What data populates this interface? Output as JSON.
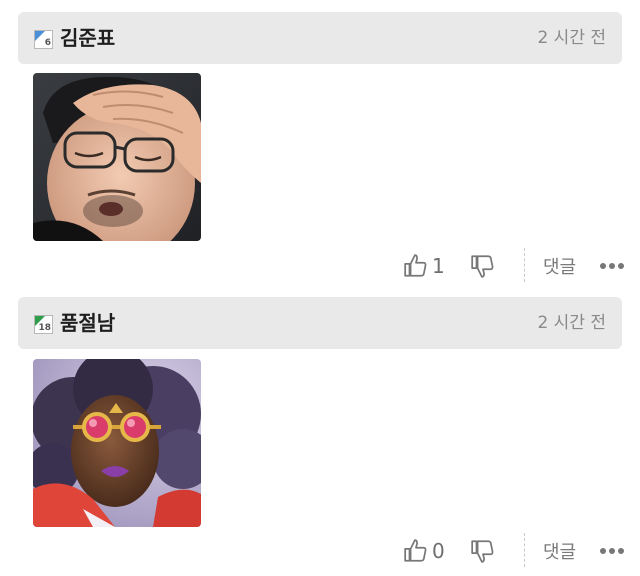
{
  "comments": [
    {
      "username": "김준표",
      "level": "6",
      "level_color": "#4a90d9",
      "time": "2 시간 전",
      "likes": "1",
      "reply_label": "댓글",
      "emoticon": "crying-man-facepalm"
    },
    {
      "username": "품절남",
      "level": "18",
      "level_color": "#2e9e4a",
      "time": "2 시간 전",
      "likes": "0",
      "reply_label": "댓글",
      "emoticon": "woman-with-goggles"
    }
  ],
  "icons": {
    "like": "thumbs-up-icon",
    "dislike": "thumbs-down-icon",
    "more": "more-dots-icon"
  },
  "colors": {
    "header_bg": "#e9e9e9",
    "icon_gray": "#777777"
  }
}
